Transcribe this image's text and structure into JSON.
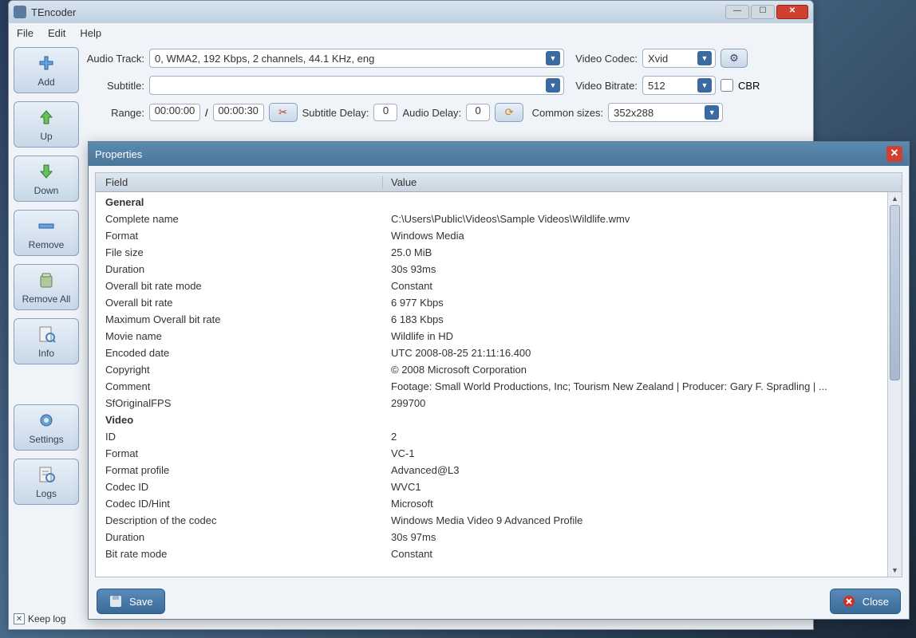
{
  "window": {
    "title": "TEncoder",
    "menu": {
      "file": "File",
      "edit": "Edit",
      "help": "Help"
    }
  },
  "sidebar": {
    "add": "Add",
    "up": "Up",
    "down": "Down",
    "remove": "Remove",
    "remove_all": "Remove All",
    "info": "Info",
    "settings": "Settings",
    "logs": "Logs",
    "keep_log": "Keep log"
  },
  "form": {
    "audio_track_label": "Audio Track:",
    "audio_track_value": "0, WMA2, 192 Kbps, 2 channels, 44.1 KHz, eng",
    "subtitle_label": "Subtitle:",
    "subtitle_value": "",
    "range_label": "Range:",
    "range_start": "00:00:00",
    "range_sep": "/",
    "range_end": "00:00:30",
    "subtitle_delay_label": "Subtitle Delay:",
    "subtitle_delay_value": "0",
    "audio_delay_label": "Audio Delay:",
    "audio_delay_value": "0",
    "video_codec_label": "Video Codec:",
    "video_codec_value": "Xvid",
    "video_bitrate_label": "Video Bitrate:",
    "video_bitrate_value": "512",
    "cbr_label": "CBR",
    "common_sizes_label": "Common sizes:",
    "common_sizes_value": "352x288"
  },
  "dialog": {
    "title": "Properties",
    "col_field": "Field",
    "col_value": "Value",
    "save": "Save",
    "close": "Close",
    "rows": [
      {
        "section": true,
        "field": "General",
        "value": ""
      },
      {
        "field": "Complete name",
        "value": "C:\\Users\\Public\\Videos\\Sample Videos\\Wildlife.wmv"
      },
      {
        "field": "Format",
        "value": "Windows Media"
      },
      {
        "field": "File size",
        "value": "25.0 MiB"
      },
      {
        "field": "Duration",
        "value": "30s 93ms"
      },
      {
        "field": "Overall bit rate mode",
        "value": "Constant"
      },
      {
        "field": "Overall bit rate",
        "value": "6 977 Kbps"
      },
      {
        "field": "Maximum Overall bit rate",
        "value": "6 183 Kbps"
      },
      {
        "field": "Movie name",
        "value": "Wildlife in HD"
      },
      {
        "field": "Encoded date",
        "value": "UTC 2008-08-25 21:11:16.400"
      },
      {
        "field": "Copyright",
        "value": "© 2008 Microsoft Corporation"
      },
      {
        "field": "Comment",
        "value": "Footage: Small World Productions, Inc; Tourism New Zealand | Producer: Gary F. Spradling | ..."
      },
      {
        "field": "SfOriginalFPS",
        "value": "299700"
      },
      {
        "section": true,
        "field": "Video",
        "value": ""
      },
      {
        "field": "ID",
        "value": "2"
      },
      {
        "field": "Format",
        "value": "VC-1"
      },
      {
        "field": "Format profile",
        "value": "Advanced@L3"
      },
      {
        "field": "Codec ID",
        "value": "WVC1"
      },
      {
        "field": "Codec ID/Hint",
        "value": "Microsoft"
      },
      {
        "field": "Description of the codec",
        "value": "Windows Media Video 9 Advanced Profile"
      },
      {
        "field": "Duration",
        "value": "30s 97ms"
      },
      {
        "field": "Bit rate mode",
        "value": "Constant"
      }
    ]
  }
}
